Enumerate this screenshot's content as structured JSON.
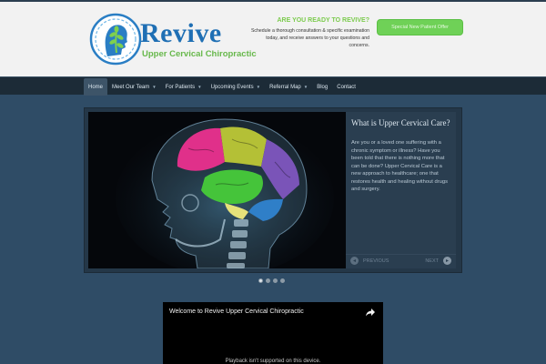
{
  "brand": {
    "name": "Revive",
    "tagline": "Upper Cervical Chiropractic"
  },
  "header_cta": {
    "heading": "ARE YOU READY TO REVIVE?",
    "body": "Schedule a thorough consultation & specific examination today, and receive answers to your questions and concerns.",
    "button_label": "Special New Patient Offer"
  },
  "nav": {
    "items": [
      {
        "label": "Home",
        "active": true,
        "dropdown": false
      },
      {
        "label": "Meet Our Team",
        "dropdown": true
      },
      {
        "label": "For Patients",
        "dropdown": true
      },
      {
        "label": "Upcoming Events",
        "dropdown": true
      },
      {
        "label": "Referral Map",
        "dropdown": true
      },
      {
        "label": "Blog",
        "dropdown": false
      },
      {
        "label": "Contact",
        "dropdown": false
      }
    ]
  },
  "slider": {
    "title": "What is Upper Cervical Care?",
    "text": "Are you or a loved one suffering with a chronic symptom or illness? Have you been told that there is nothing more that can be done? Upper Cervical Care is a new approach to healthcare; one that restores health and healing without drugs and surgery.",
    "prev_label": "Previous",
    "next_label": "Next",
    "slide_count": 4,
    "active_slide": 1
  },
  "video": {
    "title": "Welcome to Revive Upper Cervical Chiropractic",
    "message": "Playback isn't supported on this device."
  },
  "colors": {
    "page_bg": "#2f4c66",
    "brand_blue": "#1f6fb4",
    "brand_green": "#67b84b",
    "cta_green": "#6fd157",
    "nav_bg": "#1c2b37"
  }
}
